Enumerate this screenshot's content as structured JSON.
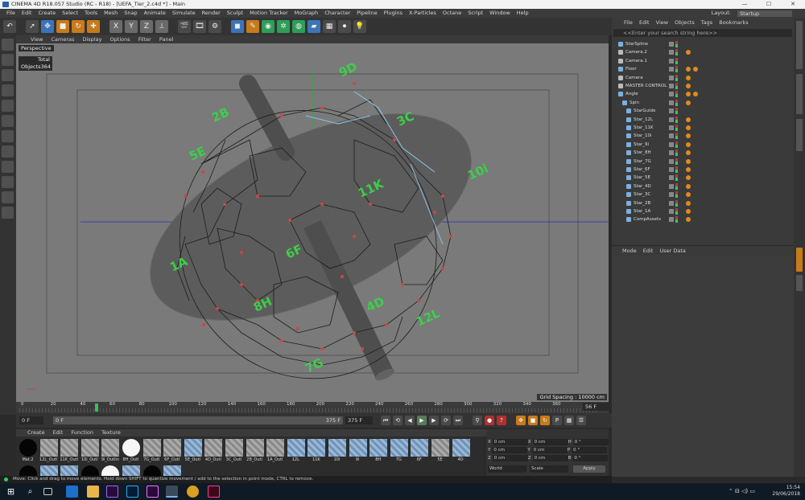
{
  "window": {
    "title": "CINEMA 4D R18.057 Studio (RC - R18) - [UEFA_Tier_2.c4d *] - Main",
    "controls": [
      "—",
      "☐",
      "✕"
    ]
  },
  "menubar": {
    "items": [
      "File",
      "Edit",
      "Create",
      "Select",
      "Tools",
      "Mesh",
      "Snap",
      "Animate",
      "Simulate",
      "Render",
      "Sculpt",
      "Motion Tracker",
      "MoGraph",
      "Character",
      "Pipeline",
      "Plugins",
      "X-Particles",
      "Octane",
      "Script",
      "Window",
      "Help"
    ],
    "layout_label": "Layout:",
    "layout_value": "Startup"
  },
  "toolbar": {
    "icons": [
      "undo-icon",
      "select-icon",
      "move-icon",
      "scale-icon",
      "rotate-icon",
      "move-plus-icon",
      "x-axis-icon",
      "y-axis-icon",
      "z-axis-icon",
      "world-coord-icon",
      "render-view-icon",
      "render-picture-queue-icon",
      "render-settings-icon",
      "cube-icon",
      "pen-icon",
      "subdivision-icon",
      "array-icon",
      "deformer-icon",
      "floor-icon",
      "camera-icon",
      "light-icon"
    ],
    "axis_labels": [
      "X",
      "Y",
      "Z"
    ]
  },
  "viewport": {
    "menu": [
      "View",
      "Cameras",
      "Display",
      "Options",
      "Filter",
      "Panel"
    ],
    "camera_label": "Perspective",
    "hud_header": "Total",
    "hud_row_label": "Objects",
    "hud_row_value": "364",
    "grid_spacing": "Grid Spacing : 10000 cm",
    "star_labels": [
      {
        "text": "9D"
      },
      {
        "text": "2B"
      },
      {
        "text": "5E"
      },
      {
        "text": "3C"
      },
      {
        "text": "10i"
      },
      {
        "text": "11K"
      },
      {
        "text": "1A"
      },
      {
        "text": "6F"
      },
      {
        "text": "8H"
      },
      {
        "text": "4D"
      },
      {
        "text": "12L"
      },
      {
        "text": "7G"
      }
    ]
  },
  "timeline": {
    "ticks": [
      "0",
      "20",
      "40",
      "60",
      "80",
      "100",
      "120",
      "140",
      "160",
      "180",
      "200",
      "220",
      "240",
      "260",
      "280",
      "300",
      "320",
      "340",
      "360"
    ],
    "current_frame_marker": "50",
    "end_frame": "56 F"
  },
  "playbar": {
    "start_field": "0 F",
    "range_start": "0 F",
    "range_end": "375 F",
    "end_field": "375 F"
  },
  "materials": {
    "menu": [
      "Create",
      "Edit",
      "Function",
      "Texture"
    ],
    "items": [
      {
        "label": "Mat.2",
        "style": "black"
      },
      {
        "label": "12L_Outl",
        "style": "hatch"
      },
      {
        "label": "11K_Outl",
        "style": "hatch"
      },
      {
        "label": "10i_Outl",
        "style": "hatch"
      },
      {
        "label": "9i_Outlin",
        "style": "hatch"
      },
      {
        "label": "8H_Outl",
        "style": "white"
      },
      {
        "label": "7G_Outl",
        "style": "hatch"
      },
      {
        "label": "6F_Outl",
        "style": "hatch"
      },
      {
        "label": "5E_Outl",
        "style": "blue"
      },
      {
        "label": "4D_Outl",
        "style": "hatch"
      },
      {
        "label": "3C_Outl",
        "style": "hatch"
      },
      {
        "label": "2B_Outl",
        "style": "hatch"
      },
      {
        "label": "1A_Outl",
        "style": "hatch"
      },
      {
        "label": "12L",
        "style": "blue"
      },
      {
        "label": "11K",
        "style": "blue"
      },
      {
        "label": "10i",
        "style": "blue"
      },
      {
        "label": "9i",
        "style": "blue"
      },
      {
        "label": "8H",
        "style": "blue"
      },
      {
        "label": "7G",
        "style": "blue"
      },
      {
        "label": "6F",
        "style": "blue"
      },
      {
        "label": "5E",
        "style": "hatch"
      },
      {
        "label": "4D",
        "style": "blue"
      }
    ]
  },
  "coordinates": {
    "rows": [
      {
        "a": "X",
        "av": "0 cm",
        "b": "X",
        "bv": "0 cm",
        "c": "H",
        "cv": "0 °"
      },
      {
        "a": "Y",
        "av": "0 cm",
        "b": "Y",
        "bv": "0 cm",
        "c": "P",
        "cv": "0 °"
      },
      {
        "a": "Z",
        "av": "0 cm",
        "b": "Z",
        "bv": "0 cm",
        "c": "B",
        "cv": "0 °"
      }
    ],
    "mode_left": "World",
    "mode_right": "Scale",
    "apply": "Apply"
  },
  "status": "Move: Click and drag to move elements. Hold down SHIFT to quantize movement / add to the selection in point mode, CTRL to remove.",
  "object_manager": {
    "menu": [
      "File",
      "Edit",
      "View",
      "Objects",
      "Tags",
      "Bookmarks"
    ],
    "search_placeholder": "<<Enter your search string here>>",
    "objects": [
      {
        "name": "StarSpline",
        "indent": 0,
        "tags": 0
      },
      {
        "name": "Camera.2",
        "indent": 0,
        "tags": 1
      },
      {
        "name": "Camera.1",
        "indent": 0,
        "tags": 0
      },
      {
        "name": "Floor",
        "indent": 0,
        "tags": 2
      },
      {
        "name": "Camera",
        "indent": 0,
        "tags": 1
      },
      {
        "name": "MASTER CONTROL",
        "indent": 0,
        "tags": 1
      },
      {
        "name": "Angle",
        "indent": 0,
        "tags": 2
      },
      {
        "name": "Spin",
        "indent": 1,
        "tags": 1
      },
      {
        "name": "StarGuide",
        "indent": 2,
        "tags": 0
      },
      {
        "name": "Star_12L",
        "indent": 2,
        "tags": 1
      },
      {
        "name": "Star_11K",
        "indent": 2,
        "tags": 1
      },
      {
        "name": "Star_10i",
        "indent": 2,
        "tags": 1
      },
      {
        "name": "Star_9i",
        "indent": 2,
        "tags": 1
      },
      {
        "name": "Star_8H",
        "indent": 2,
        "tags": 1
      },
      {
        "name": "Star_7G",
        "indent": 2,
        "tags": 1
      },
      {
        "name": "Star_6F",
        "indent": 2,
        "tags": 1
      },
      {
        "name": "Star_5E",
        "indent": 2,
        "tags": 1
      },
      {
        "name": "Star_4D",
        "indent": 2,
        "tags": 1
      },
      {
        "name": "Star_3C",
        "indent": 2,
        "tags": 1
      },
      {
        "name": "Star_2B",
        "indent": 2,
        "tags": 1
      },
      {
        "name": "Star_1A",
        "indent": 2,
        "tags": 1
      },
      {
        "name": "CompAssets",
        "indent": 2,
        "tags": 1
      }
    ]
  },
  "attribute_manager": {
    "menu": [
      "Mode",
      "Edit",
      "User Data"
    ]
  },
  "taskbar": {
    "time": "15:54",
    "date": "29/06/2018"
  },
  "colors": {
    "viewport_bg": "#7a7a7a",
    "star_label": "#3ccf4a",
    "tag_orange": "#e08a1e",
    "select_blue": "#3d74b8"
  }
}
